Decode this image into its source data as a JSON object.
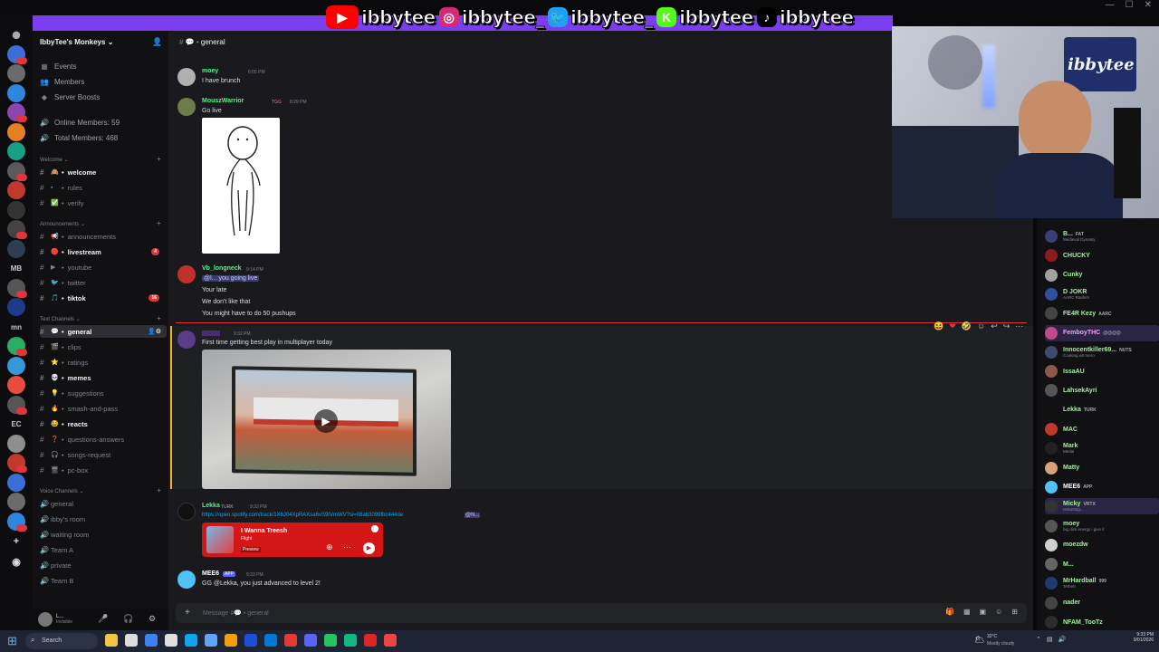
{
  "stream_overlay": {
    "handles": [
      {
        "platform": "youtube-icon",
        "handle": "ibbytee",
        "color": "#ff0000"
      },
      {
        "platform": "instagram-icon",
        "handle": "ibbytee_",
        "color": "#d62976"
      },
      {
        "platform": "twitter-icon",
        "handle": "ibbytee_",
        "color": "#1da1f2"
      },
      {
        "platform": "kick-icon",
        "handle": "ibbytee",
        "color": "#53fc18"
      },
      {
        "platform": "tiktok-icon",
        "handle": "ibbytee",
        "color": "#000000"
      }
    ],
    "banner_color": "#7b3df0"
  },
  "server": {
    "name": "IbbyTee's Monkeys",
    "nav": [
      "Events",
      "Members",
      "Server Boosts"
    ],
    "stats": [
      "Online Members: 59",
      "Total Members: 468"
    ]
  },
  "categories": {
    "welcome": "Welcome",
    "announcements": "Announcements",
    "text": "Text Channels",
    "voice": "Voice Channels"
  },
  "channels": {
    "welcome": [
      {
        "name": "welcome",
        "emoji": "🙈",
        "bold": true
      },
      {
        "name": "rules",
        "emoji": "▪"
      },
      {
        "name": "verify",
        "emoji": "✅"
      }
    ],
    "announcements": [
      {
        "name": "announcements",
        "emoji": "📢"
      },
      {
        "name": "livestream",
        "emoji": "🔴",
        "bold": true,
        "badge": "4"
      },
      {
        "name": "youtube",
        "emoji": "▶"
      },
      {
        "name": "twitter",
        "emoji": "🐦"
      },
      {
        "name": "tiktok",
        "emoji": "🎵",
        "bold": true,
        "badge": "16"
      }
    ],
    "text": [
      {
        "name": "general",
        "emoji": "💬",
        "active": true
      },
      {
        "name": "clips",
        "emoji": "🎬"
      },
      {
        "name": "ratings",
        "emoji": "⭐"
      },
      {
        "name": "memes",
        "emoji": "💀",
        "bold": true
      },
      {
        "name": "suggestions",
        "emoji": "💡"
      },
      {
        "name": "smash-and-pass",
        "emoji": "🔥"
      },
      {
        "name": "reacts",
        "emoji": "😂",
        "bold": true
      },
      {
        "name": "questions-answers",
        "emoji": "❓"
      },
      {
        "name": "songs-request",
        "emoji": "🎧"
      },
      {
        "name": "pc-box",
        "emoji": "🖥"
      }
    ],
    "voice": [
      "general",
      "ibby's room",
      "waiting room",
      "Team A",
      "private",
      "Team B"
    ]
  },
  "chat": {
    "channel": "general",
    "messages": [
      {
        "user": "moey",
        "color": "#57f287",
        "time": "6:05 PM",
        "text": "I have brunch",
        "avatar": "#b0b0b0"
      },
      {
        "user": "MouszWarrior",
        "color": "#57f287",
        "tag": "TGG",
        "time": "8:29 PM",
        "text": "Go live",
        "avatar": "#6e7b4a"
      },
      {
        "user": "Vb_longneck",
        "color": "#57f287",
        "time": "9:14 PM",
        "lines": [
          "@l... you going live",
          "Your late",
          "We don't like that",
          "You might have to do 50 pushups"
        ],
        "avatar": "#c0312b"
      },
      {
        "user": "",
        "color": "#d070ff",
        "time": "9:32 PM",
        "text": "First time getting best play in multiplayer today",
        "avatar": "#5a3c88"
      },
      {
        "user": "Lekka",
        "color": "#57f287",
        "tag": "TURK",
        "time": "9:33 PM",
        "link": "https://open.spotify.com/track/1X6J04XpRAXsa6vS9IVmWV?si=08ab3099fbc444de",
        "mention": "@N...",
        "avatar": "#111"
      },
      {
        "user": "MEE6",
        "color": "#ffffff",
        "tag": "APP",
        "time": "9:33 PM",
        "text": "GG @Lekka, you just advanced to level 2!",
        "avatar": "#4fc3f7"
      }
    ],
    "spotify": {
      "title": "I Wanna Treesh",
      "artist": "Flight",
      "preview": "Preview",
      "color": "#d41616"
    },
    "composer_placeholder": "Message #💬 • general"
  },
  "members": [
    {
      "name": "B...",
      "sub": "Medieval Dynasty",
      "tag": "FAT"
    },
    {
      "name": "CHUCKY"
    },
    {
      "name": "Cunky"
    },
    {
      "name": "D JOKR",
      "sub": "AARC Raiders"
    },
    {
      "name": "FE4R Kezy",
      "tag": "AARC"
    },
    {
      "name": "FemboyTHC",
      "tag": "@@@@"
    },
    {
      "name": "Innocentkiller69...",
      "sub": "Cooking wit mero",
      "tag": "NUTS"
    },
    {
      "name": "IssaAU"
    },
    {
      "name": "LahsekAyri"
    },
    {
      "name": "Lekka",
      "tag": "TURK"
    },
    {
      "name": "MAC"
    },
    {
      "name": "Mark",
      "sub": "Medal"
    },
    {
      "name": "Matty"
    },
    {
      "name": "MEE6",
      "tag": "APP"
    },
    {
      "name": "Micky",
      "sub": "restarting...",
      "tag": "VRTX"
    },
    {
      "name": "moey",
      "sub": "big dick energy i give it"
    },
    {
      "name": "moezdw"
    },
    {
      "name": "M..."
    },
    {
      "name": "MrHardball",
      "sub": "Tetherr",
      "tag": "999"
    },
    {
      "name": "nader"
    },
    {
      "name": "NFAM_TooTz"
    }
  ],
  "webcam": {
    "logo_text": "ibbytee"
  },
  "taskbar": {
    "search": "Search",
    "weather": "32°C",
    "weather_sub": "Mostly cloudy",
    "time": "9:33 PM",
    "date": "9/01/2026"
  }
}
